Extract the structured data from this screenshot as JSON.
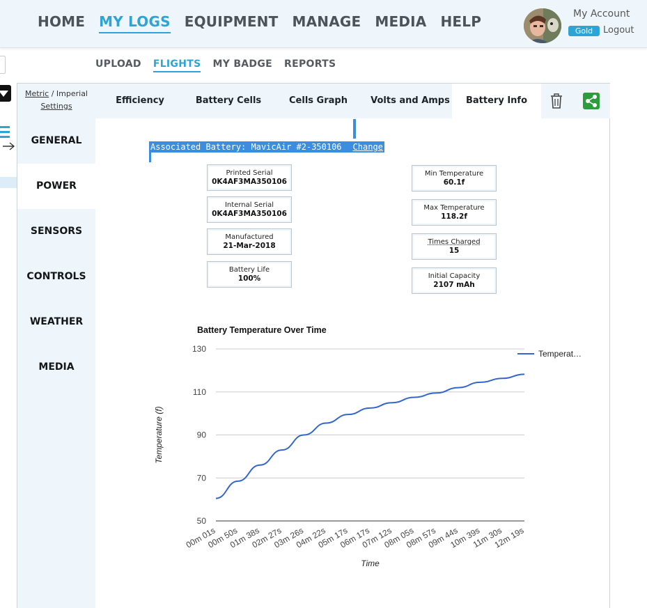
{
  "header": {
    "nav": [
      "HOME",
      "MY LOGS",
      "EQUIPMENT",
      "MANAGE",
      "MEDIA",
      "HELP"
    ],
    "active_nav": "MY LOGS",
    "account_label": "My Account",
    "badge": "Gold",
    "logout": "Logout"
  },
  "subnav": {
    "items": [
      "UPLOAD",
      "FLIGHTS",
      "MY BADGE",
      "REPORTS"
    ],
    "active": "FLIGHTS"
  },
  "units": {
    "metric": "Metric",
    "separator": "/",
    "imperial": "Imperial",
    "settings": "Settings"
  },
  "tabs": {
    "items": [
      "Efficiency",
      "Battery Cells",
      "Cells Graph",
      "Volts and Amps",
      "Battery Info"
    ],
    "active": "Battery Info"
  },
  "sidebar": {
    "items": [
      "GENERAL",
      "POWER",
      "SENSORS",
      "CONTROLS",
      "WEATHER",
      "MEDIA"
    ],
    "active": "POWER"
  },
  "battery": {
    "associated": "Associated Battery: MavicAir #2-350106",
    "change": "Change",
    "left": [
      {
        "label": "Printed Serial",
        "value": "0K4AF3MA350106"
      },
      {
        "label": "Internal Serial",
        "value": "0K4AF3MA350106"
      },
      {
        "label": "Manufactured",
        "value": "21-Mar-2018"
      },
      {
        "label": "Battery Life",
        "value": "100%"
      }
    ],
    "right": [
      {
        "label": "Min Temperature",
        "value": "60.1f"
      },
      {
        "label": "Max Temperature",
        "value": "118.2f"
      },
      {
        "label": "Times Charged",
        "value": "15"
      },
      {
        "label": "Initial Capacity",
        "value": "2107 mAh"
      }
    ]
  },
  "colors": {
    "accent": "#2ea3d6",
    "selection": "#3b8de0",
    "line": "#3366cc",
    "share": "#2e9c3c"
  },
  "chart_data": {
    "type": "line",
    "title": "Battery Temperature Over Time",
    "xlabel": "Time",
    "ylabel": "Temperature (f)",
    "ylim": [
      50,
      130
    ],
    "yticks": [
      50,
      70,
      90,
      110,
      130
    ],
    "xticks": [
      "00m 01s",
      "00m 50s",
      "01m 38s",
      "02m 27s",
      "03m 26s",
      "04m 22s",
      "05m 17s",
      "06m 17s",
      "07m 12s",
      "08m 05s",
      "08m 57s",
      "09m 44s",
      "10m 39s",
      "11m 30s",
      "12m 19s"
    ],
    "grid": true,
    "legend": "top-right",
    "series": [
      {
        "name": "Temperat…",
        "x": [
          "00m 01s",
          "00m 50s",
          "01m 38s",
          "02m 27s",
          "03m 26s",
          "04m 22s",
          "05m 17s",
          "06m 17s",
          "07m 12s",
          "08m 05s",
          "08m 57s",
          "09m 44s",
          "10m 39s",
          "11m 30s",
          "12m 19s"
        ],
        "values": [
          60.5,
          68.5,
          76,
          83,
          90,
          95.5,
          99.5,
          102.5,
          105,
          107.5,
          109.5,
          112,
          114.5,
          116.3,
          118.2
        ]
      }
    ]
  }
}
